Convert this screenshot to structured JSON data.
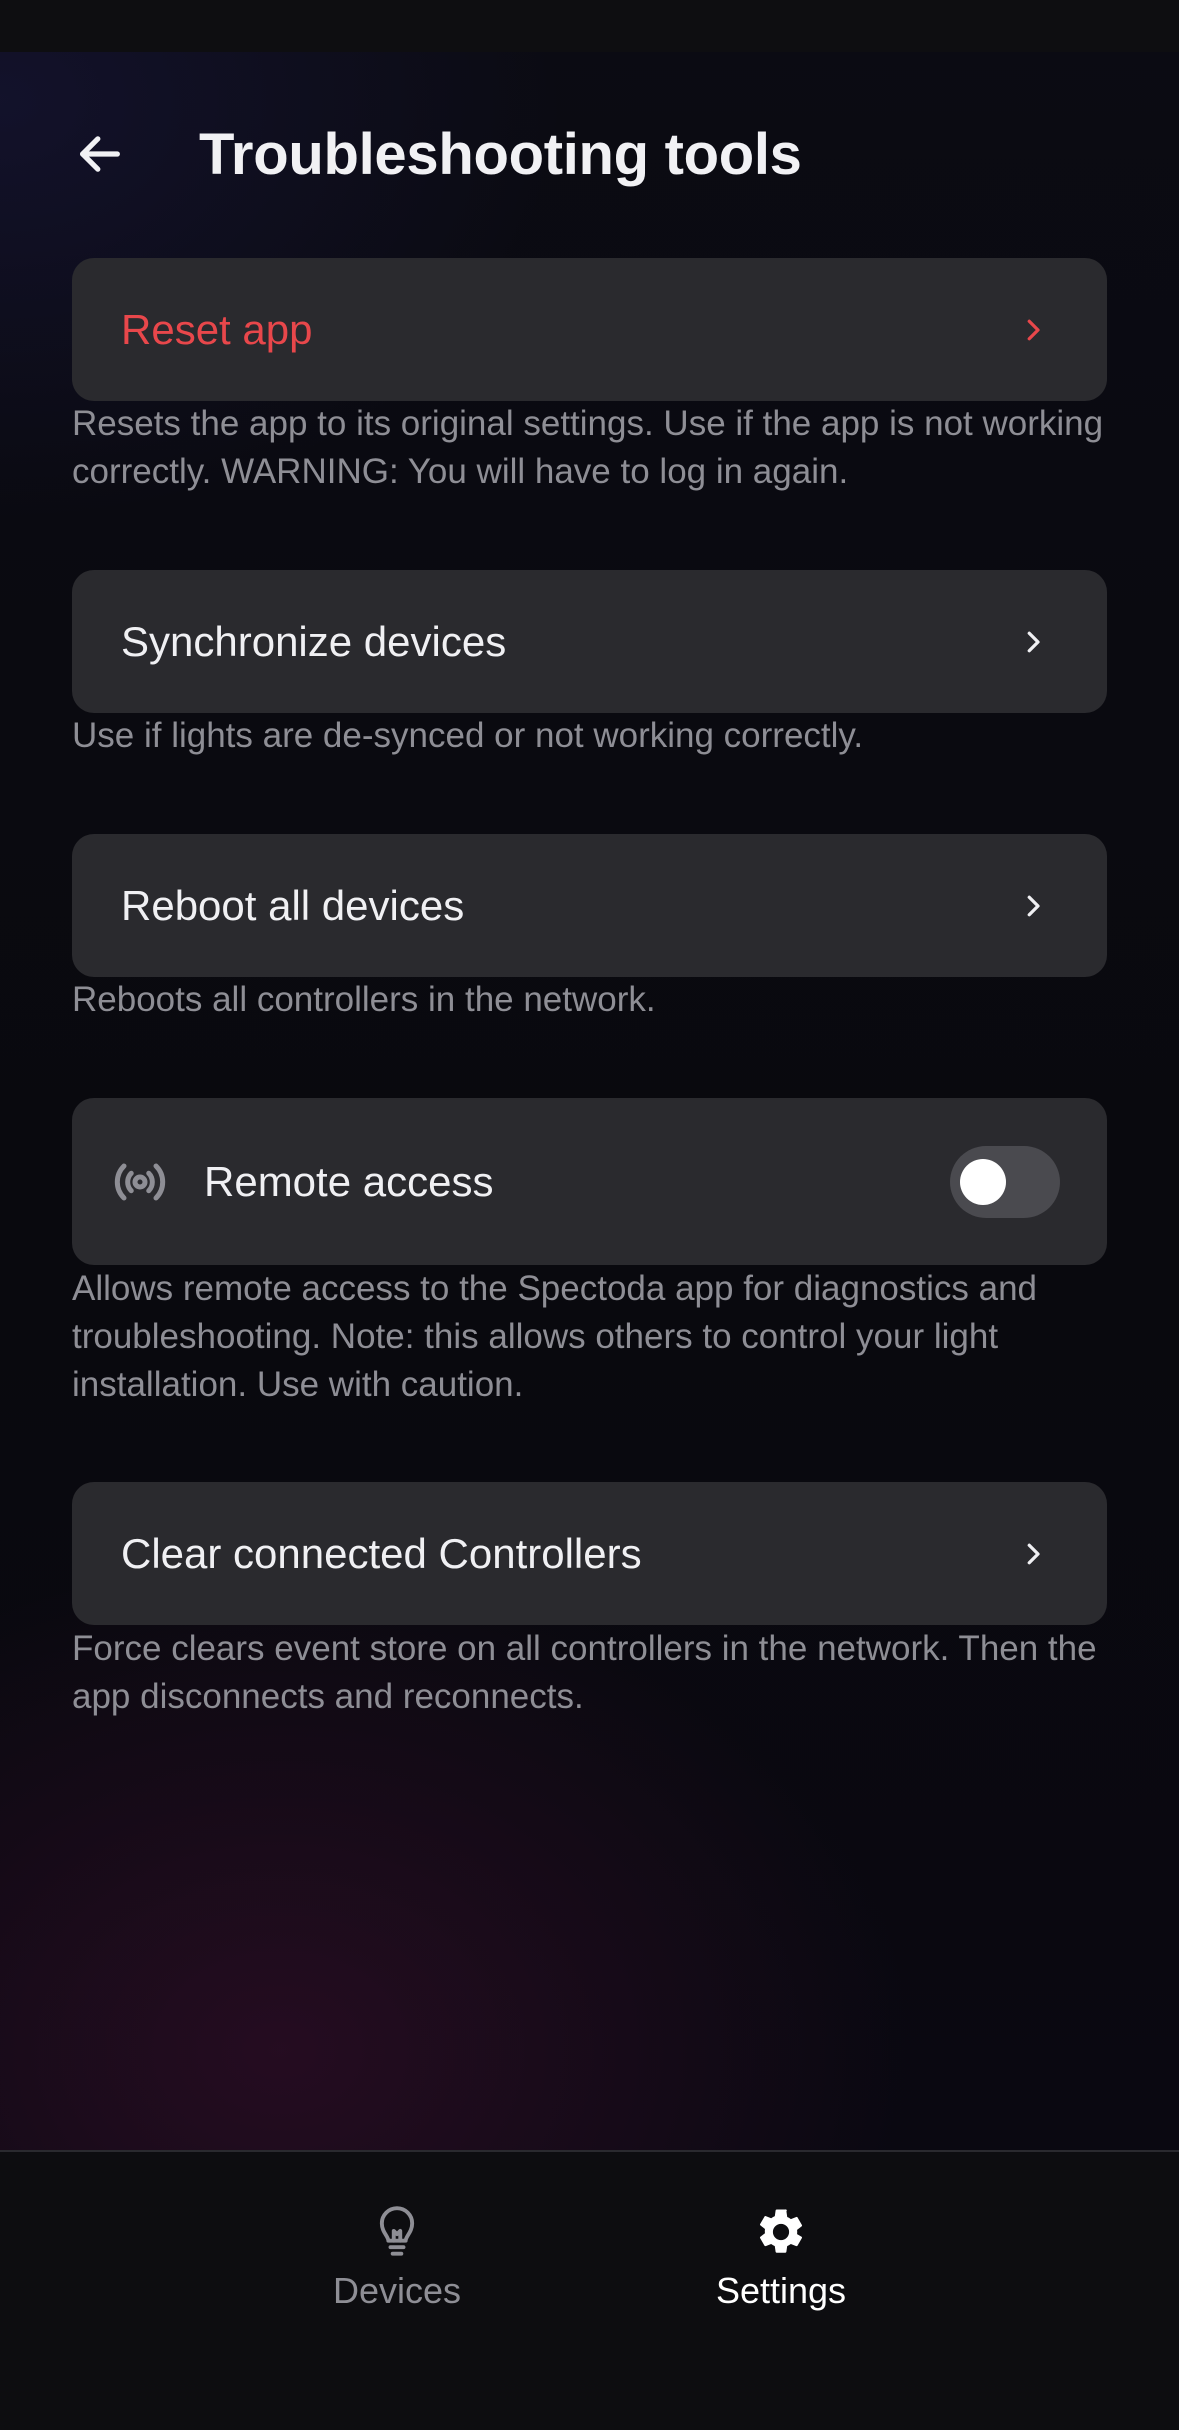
{
  "header": {
    "title": "Troubleshooting tools",
    "back_icon": "arrow-left-icon"
  },
  "items": [
    {
      "label": "Reset app",
      "description": "Resets the app to its original settings. Use if the app is not working correctly. WARNING: You will have to log in again.",
      "style": "danger",
      "accent_color": "#e8474b"
    },
    {
      "label": "Synchronize devices",
      "description": "Use if lights are de-synced or not working correctly."
    },
    {
      "label": "Reboot all devices",
      "description": "Reboots all controllers in the network."
    },
    {
      "label": "Remote access",
      "description": "Allows remote access to the Spectoda app for diagnostics and troubleshooting. Note: this allows others to control your light installation. Use with caution.",
      "icon": "broadcast-icon",
      "toggle_on": false
    },
    {
      "label": "Clear connected Controllers",
      "description": "Force clears event store on all controllers in the network. Then the app disconnects and reconnects."
    }
  ],
  "bottom_nav": {
    "devices": {
      "label": "Devices",
      "icon": "lightbulb-icon",
      "active": false
    },
    "settings": {
      "label": "Settings",
      "icon": "gear-icon",
      "active": true
    }
  },
  "colors": {
    "card_background": "#2a2a2e",
    "description_text": "#8e8e95",
    "danger": "#e8474b"
  }
}
